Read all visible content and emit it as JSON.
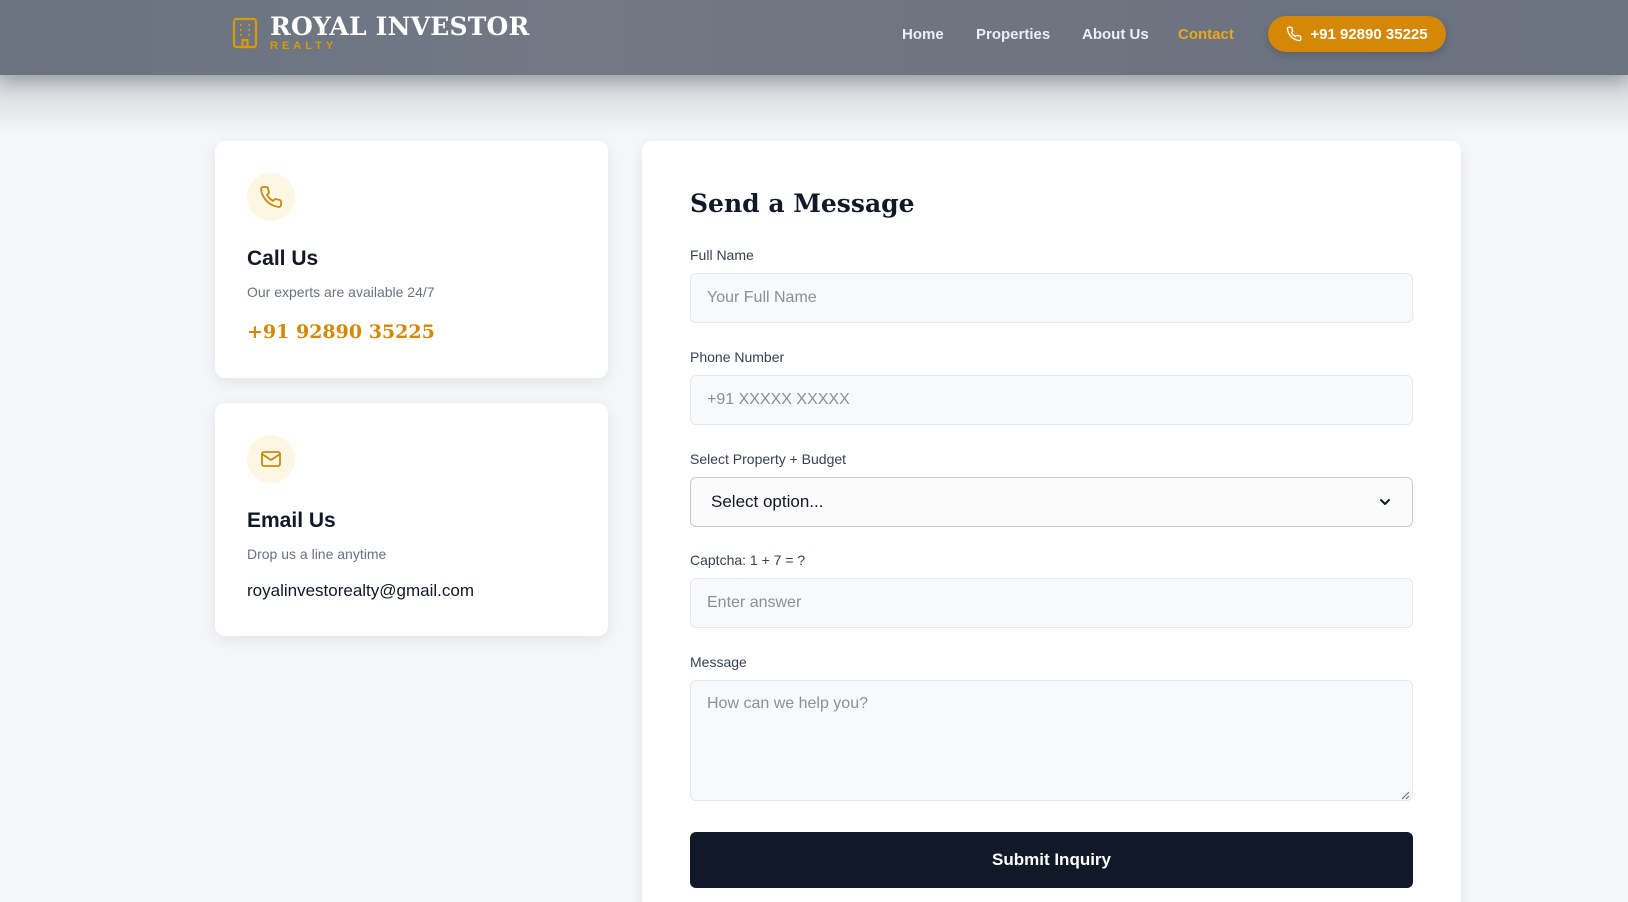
{
  "header": {
    "logo_title": "ROYAL INVESTOR",
    "logo_subtitle": "REALTY",
    "nav": [
      {
        "label": "Home"
      },
      {
        "label": "Properties"
      },
      {
        "label": "About Us"
      },
      {
        "label": "Contact",
        "active": true
      }
    ],
    "call_button_label": "+91 92890 35225"
  },
  "cards": {
    "call": {
      "title": "Call Us",
      "description": "Our experts are available 24/7",
      "phone": "+91 92890 35225"
    },
    "email": {
      "title": "Email Us",
      "description": "Drop us a line anytime",
      "address": "royalinvestorealty@gmail.com"
    }
  },
  "form": {
    "title": "Send a Message",
    "full_name": {
      "label": "Full Name",
      "placeholder": "Your Full Name",
      "value": ""
    },
    "phone": {
      "label": "Phone Number",
      "placeholder": "+91 XXXXX XXXXX",
      "value": ""
    },
    "property": {
      "label": "Select Property + Budget",
      "selected": "Select option..."
    },
    "captcha": {
      "label": "Captcha: 1 + 7 = ?",
      "placeholder": "Enter answer",
      "value": ""
    },
    "message": {
      "label": "Message",
      "placeholder": "How can we help you?",
      "value": ""
    },
    "submit_label": "Submit Inquiry"
  },
  "colors": {
    "accent": "#d48806",
    "accent_light": "#e9a919",
    "dark": "#111827",
    "header_bg": "#6b7280"
  },
  "icons": {
    "logo": "building-icon",
    "call": "phone-icon",
    "email": "mail-icon",
    "select": "chevron-down-icon"
  }
}
